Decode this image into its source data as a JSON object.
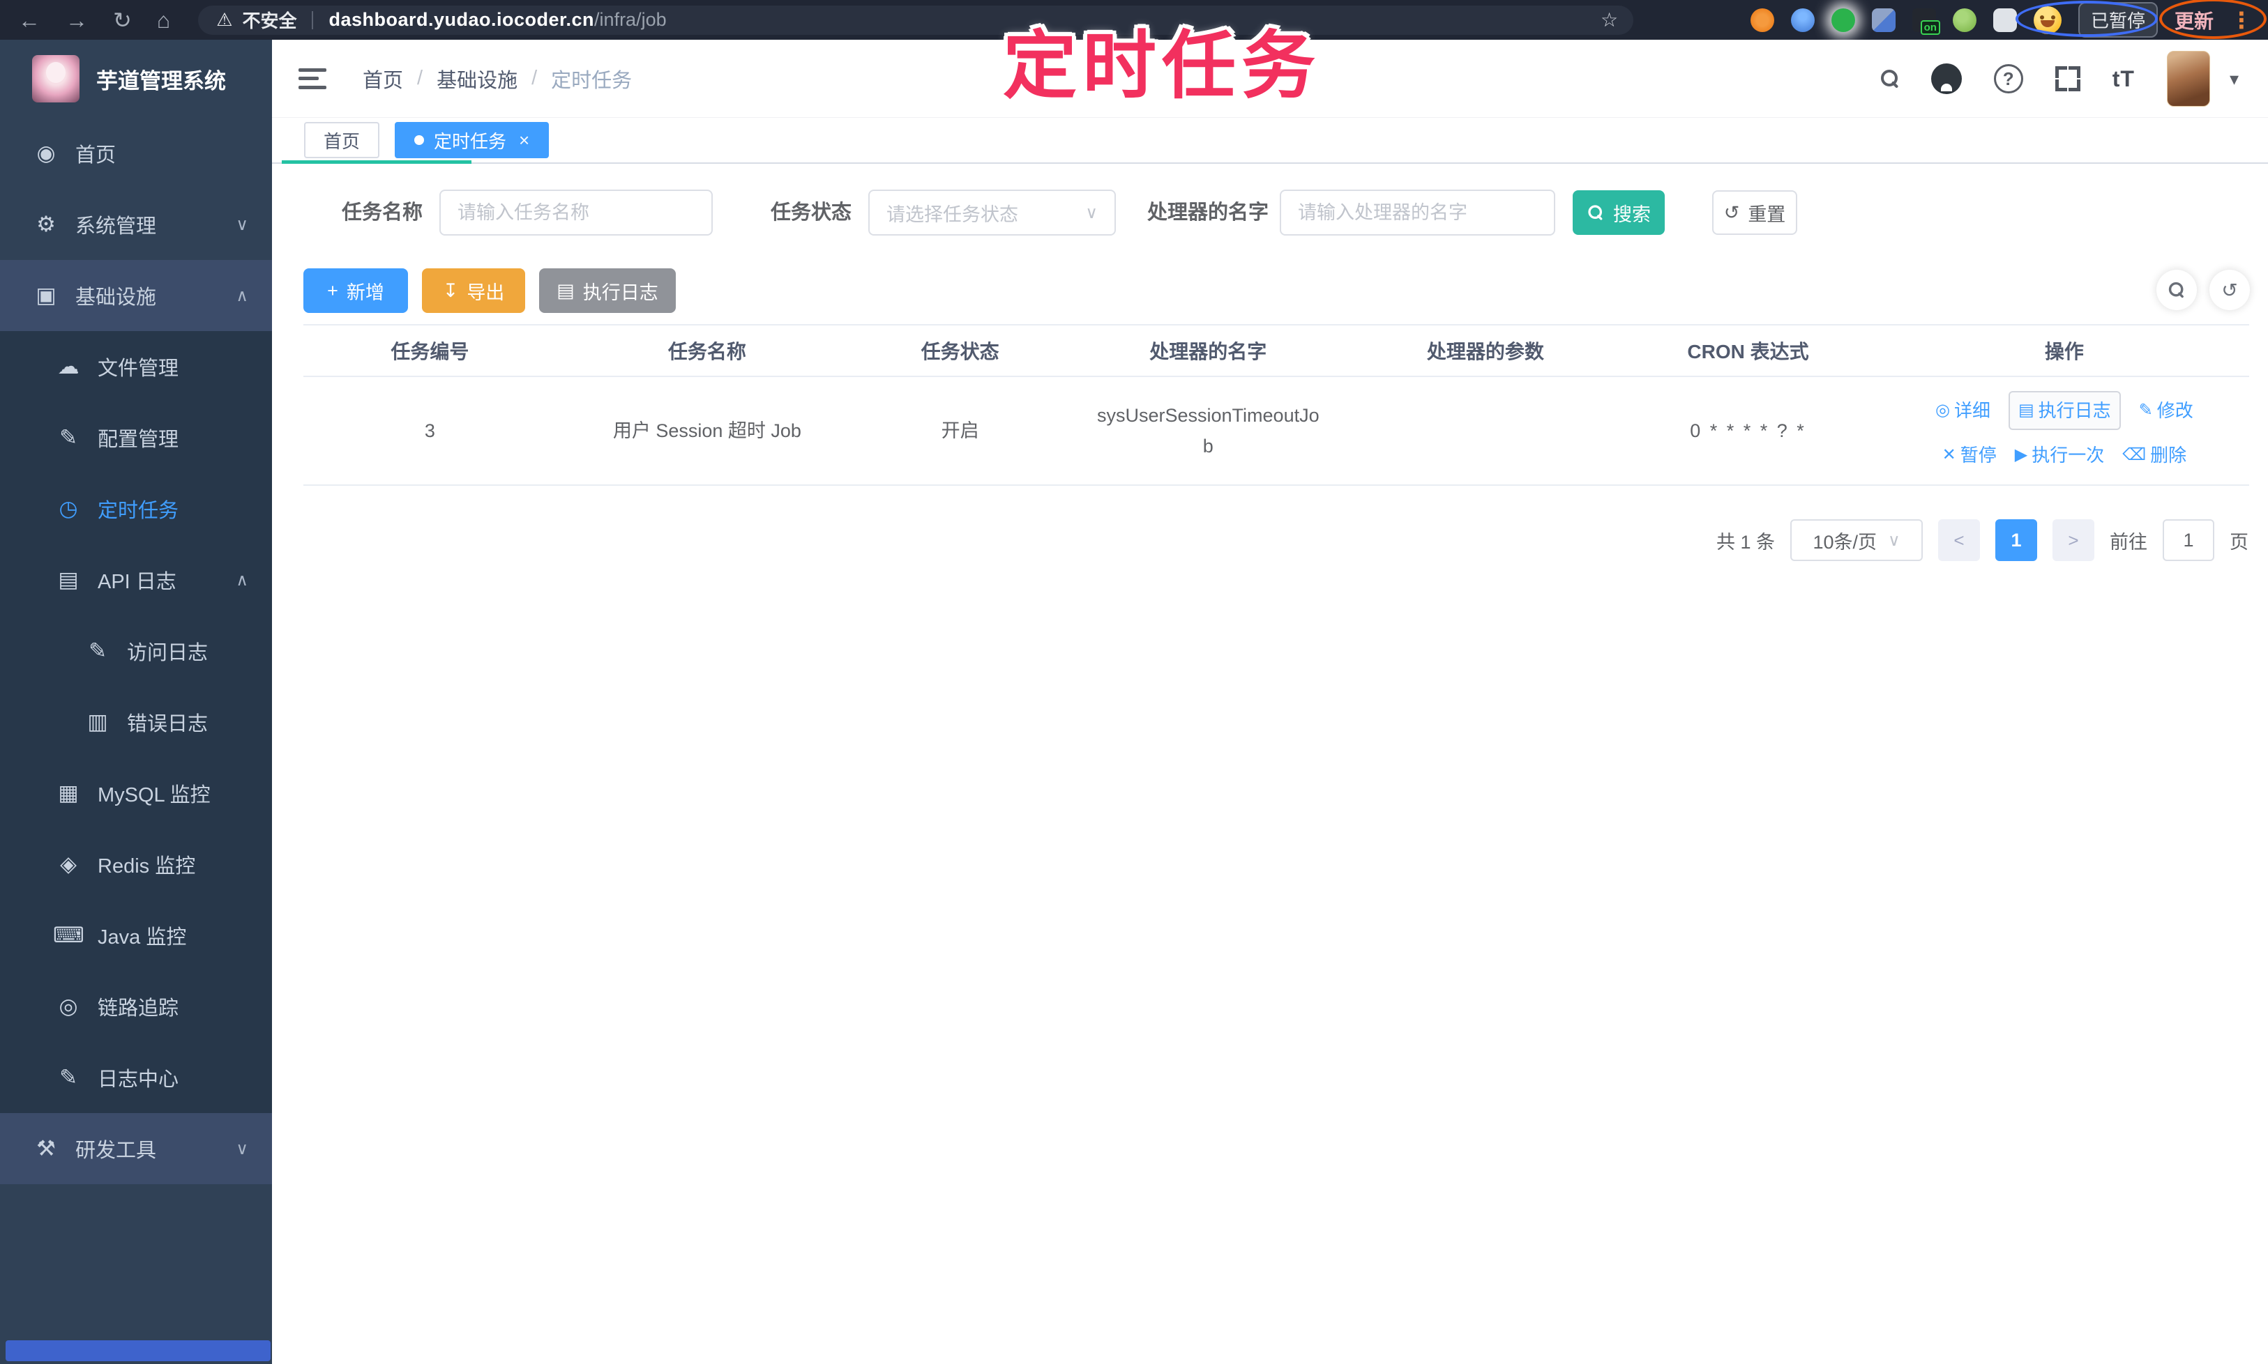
{
  "colors": {
    "accent_blue": "#409EFF",
    "teal_search": "#2cb9a2",
    "warning_yellow": "#f0a73c",
    "info_gray": "#909399",
    "sidebar_bg": "#304156",
    "sidebar_submenu_bg": "#27374a",
    "sidebar_highlight_bg": "#3c4c6a",
    "chrome_bg": "#202634",
    "annotation_pink": "#f2305e",
    "annotation_blue": "#3f6df5",
    "annotation_orange": "#e8590c",
    "progress_teal": "#24c2a3"
  },
  "annotation": {
    "title": "定时任务"
  },
  "browser": {
    "back_icon": "←",
    "forward_icon": "→",
    "reload_icon": "↻",
    "home_icon": "⌂",
    "warning_icon": "⚠",
    "security_label": "不安全",
    "url_host": "dashboard.yudao.iocoder.cn",
    "url_path": "/infra/job",
    "bookmark_star_icon": "☆",
    "extension_on_badge": "on",
    "paused_badge": "已暂停",
    "update_button": "更新",
    "kebab_icon": "⋮"
  },
  "sidebar": {
    "app_title": "芋道管理系统",
    "items": [
      {
        "icon": "◉",
        "label": "首页"
      },
      {
        "icon": "⚙",
        "label": "系统管理",
        "chevron": "∨"
      },
      {
        "icon": "▣",
        "label": "基础设施",
        "chevron": "∧"
      },
      {
        "icon": "☁",
        "label": "文件管理"
      },
      {
        "icon": "✎",
        "label": "配置管理"
      },
      {
        "icon": "◷",
        "label": "定时任务"
      },
      {
        "icon": "▤",
        "label": "API 日志",
        "chevron": "∧"
      },
      {
        "icon": "✎",
        "label": "访问日志"
      },
      {
        "icon": "▥",
        "label": "错误日志"
      },
      {
        "icon": "▦",
        "label": "MySQL 监控"
      },
      {
        "icon": "◈",
        "label": "Redis 监控"
      },
      {
        "icon": "⌨",
        "label": "Java 监控"
      },
      {
        "icon": "◎",
        "label": "链路追踪"
      },
      {
        "icon": "✎",
        "label": "日志中心"
      },
      {
        "icon": "⚒",
        "label": "研发工具",
        "chevron": "∨"
      }
    ]
  },
  "header": {
    "breadcrumb": [
      "首页",
      "基础设施",
      "定时任务"
    ],
    "breadcrumb_separator": "/",
    "help_icon": "?",
    "font_size_icon": "tT",
    "caret_icon": "▾"
  },
  "tabs": [
    {
      "label": "首页"
    },
    {
      "label": "定时任务",
      "close_icon": "×"
    }
  ],
  "filters": {
    "name_label": "任务名称",
    "name_placeholder": "请输入任务名称",
    "status_label": "任务状态",
    "status_placeholder": "请选择任务状态",
    "status_caret": "∨",
    "handler_label": "处理器的名字",
    "handler_placeholder": "请输入处理器的名字",
    "search_label": "搜索",
    "reset_label": "重置",
    "reset_icon": "↺"
  },
  "toolbar": {
    "add_icon": "+",
    "add_label": "新增",
    "export_icon": "↧",
    "export_label": "导出",
    "exec_log_icon": "▤",
    "exec_log_label": "执行日志",
    "refresh_icon": "↺"
  },
  "table": {
    "columns": [
      "任务编号",
      "任务名称",
      "任务状态",
      "处理器的名字",
      "处理器的参数",
      "CRON 表达式",
      "操作"
    ],
    "rows": [
      {
        "id": "3",
        "name": "用户 Session 超时 Job",
        "status": "开启",
        "handler": "sysUserSessionTimeoutJob",
        "params": "",
        "cron": "0 * * * * ? *"
      }
    ],
    "actions_line1": [
      {
        "icon": "◎",
        "label": "详细"
      },
      {
        "icon": "▤",
        "label": "执行日志"
      },
      {
        "icon": "✎",
        "label": "修改"
      }
    ],
    "actions_line2": [
      {
        "icon": "✕",
        "label": "暂停"
      },
      {
        "icon": "▶",
        "label": "执行一次"
      },
      {
        "icon": "⌫",
        "label": "删除"
      }
    ]
  },
  "pagination": {
    "total": "共 1 条",
    "page_size": "10条/页",
    "size_caret": "∨",
    "prev_icon": "<",
    "next_icon": ">",
    "page": "1",
    "goto_label": "前往",
    "goto_value": "1",
    "page_suffix": "页"
  }
}
